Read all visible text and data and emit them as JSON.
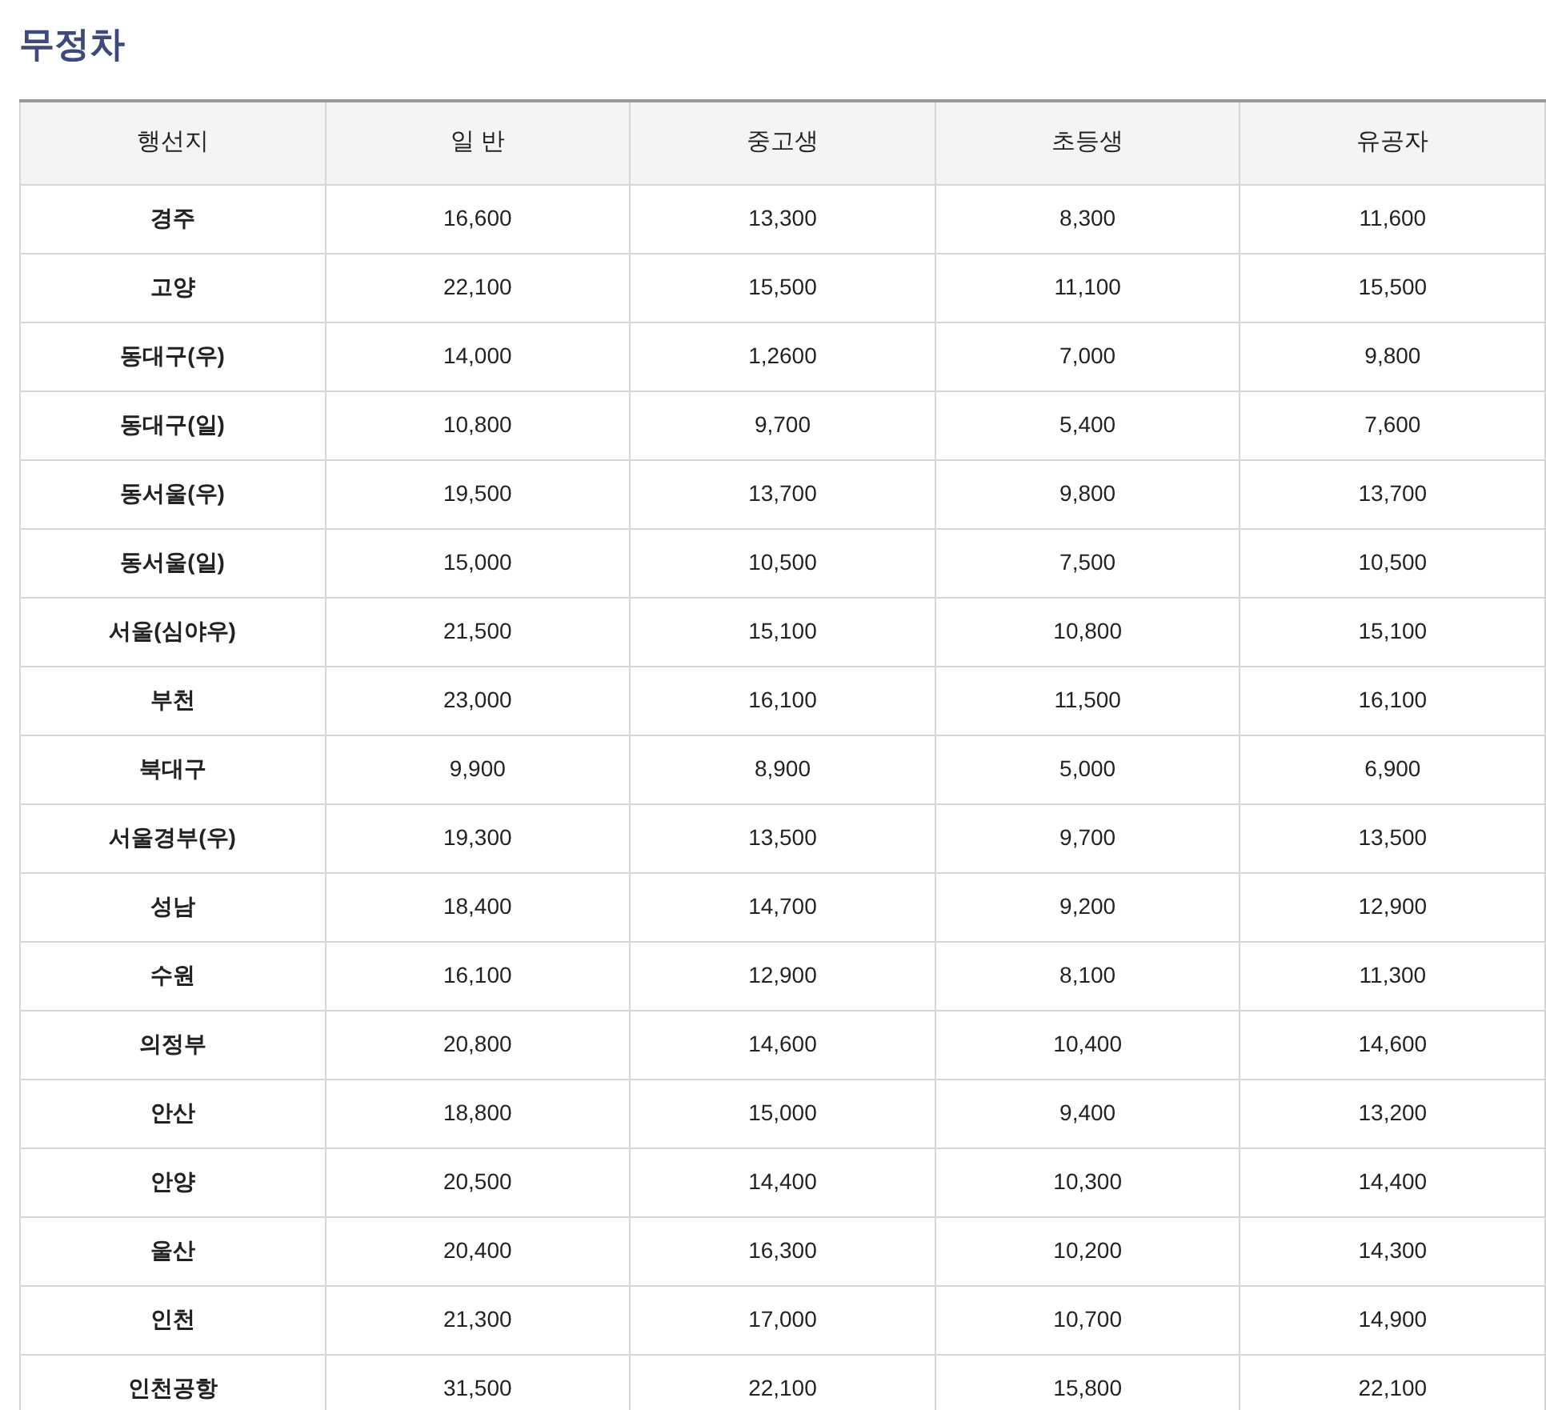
{
  "title": "무정차",
  "table": {
    "columns": [
      "행선지",
      "일 반",
      "중고생",
      "초등생",
      "유공자"
    ],
    "rows": [
      [
        "경주",
        "16,600",
        "13,300",
        "8,300",
        "11,600"
      ],
      [
        "고양",
        "22,100",
        "15,500",
        "11,100",
        "15,500"
      ],
      [
        "동대구(우)",
        "14,000",
        "1,2600",
        "7,000",
        "9,800"
      ],
      [
        "동대구(일)",
        "10,800",
        "9,700",
        "5,400",
        "7,600"
      ],
      [
        "동서울(우)",
        "19,500",
        "13,700",
        "9,800",
        "13,700"
      ],
      [
        "동서울(일)",
        "15,000",
        "10,500",
        "7,500",
        "10,500"
      ],
      [
        "서울(심야우)",
        "21,500",
        "15,100",
        "10,800",
        "15,100"
      ],
      [
        "부천",
        "23,000",
        "16,100",
        "11,500",
        "16,100"
      ],
      [
        "북대구",
        "9,900",
        "8,900",
        "5,000",
        "6,900"
      ],
      [
        "서울경부(우)",
        "19,300",
        "13,500",
        "9,700",
        "13,500"
      ],
      [
        "성남",
        "18,400",
        "14,700",
        "9,200",
        "12,900"
      ],
      [
        "수원",
        "16,100",
        "12,900",
        "8,100",
        "11,300"
      ],
      [
        "의정부",
        "20,800",
        "14,600",
        "10,400",
        "14,600"
      ],
      [
        "안산",
        "18,800",
        "15,000",
        "9,400",
        "13,200"
      ],
      [
        "안양",
        "20,500",
        "14,400",
        "10,300",
        "14,400"
      ],
      [
        "울산",
        "20,400",
        "16,300",
        "10,200",
        "14,300"
      ],
      [
        "인천",
        "21,300",
        "17,000",
        "10,700",
        "14,900"
      ],
      [
        "인천공항",
        "31,500",
        "22,100",
        "15,800",
        "22,100"
      ]
    ]
  }
}
